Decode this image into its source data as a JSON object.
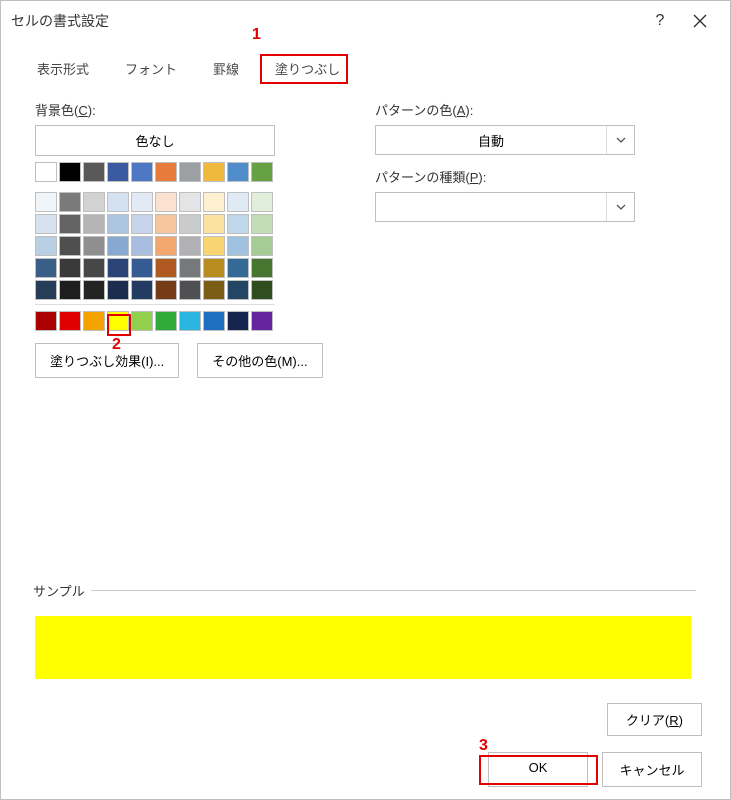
{
  "title": "セルの書式設定",
  "tabs": [
    "表示形式",
    "フォント",
    "罫線",
    "塗りつぶし"
  ],
  "active_tab_index": 3,
  "annotations": {
    "a1": "1",
    "a2": "2",
    "a3": "3"
  },
  "left": {
    "bg_label_pre": "背景色(",
    "bg_label_ul": "C",
    "bg_label_post": "):",
    "no_color": "色なし",
    "theme_row1": [
      "#ffffff",
      "#000000",
      "#595959",
      "#3b5ba0",
      "#4e78c6",
      "#e77b3b",
      "#9da0a3",
      "#efb93e",
      "#4e8dc9",
      "#66a244"
    ],
    "theme_grid": [
      [
        "#f0f5fa",
        "#7a7a7a",
        "#d2d2d2",
        "#d3e1f0",
        "#e2eaf5",
        "#fbe1cf",
        "#e3e4e5",
        "#fdf0d0",
        "#dfeaf5",
        "#e1eedb"
      ],
      [
        "#d6e2ef",
        "#636363",
        "#b5b5b5",
        "#adc5e0",
        "#c5d4ea",
        "#f6c49f",
        "#c9cbcd",
        "#fbe2a1",
        "#bfd6eb",
        "#c3ddb8"
      ],
      [
        "#b9cfe4",
        "#4f4f4f",
        "#8f8f8f",
        "#87a8d0",
        "#a8bde0",
        "#f1a76f",
        "#afb1b4",
        "#f9d472",
        "#9fc2e1",
        "#a5cc95"
      ],
      [
        "#3a5f86",
        "#3a3a3a",
        "#474747",
        "#2b4478",
        "#365a94",
        "#b05a22",
        "#76797c",
        "#b98c20",
        "#356a97",
        "#477631"
      ],
      [
        "#253d57",
        "#1e1e1e",
        "#232323",
        "#1b2c4e",
        "#233b62",
        "#743b16",
        "#4e5053",
        "#7b5d15",
        "#234664",
        "#2f4e20"
      ]
    ],
    "standard": [
      "#ab0000",
      "#e10000",
      "#f4a200",
      "#ffff00",
      "#91cf4f",
      "#2faa3b",
      "#2bb6e2",
      "#1e6fc0",
      "#17254e",
      "#6524a0"
    ],
    "fill_effects_label": "塗りつぶし効果(I)...",
    "more_colors_label": "その他の色(M)..."
  },
  "right": {
    "pattern_color_pre": "パターンの色(",
    "pattern_color_ul": "A",
    "pattern_color_post": "):",
    "pattern_color_value": "自動",
    "pattern_type_pre": "パターンの種類(",
    "pattern_type_ul": "P",
    "pattern_type_post": "):",
    "pattern_type_value": ""
  },
  "sample": {
    "label": "サンプル",
    "color": "#ffff00"
  },
  "clear_pre": "クリア(",
  "clear_ul": "R",
  "clear_post": ")",
  "ok": "OK",
  "cancel": "キャンセル"
}
